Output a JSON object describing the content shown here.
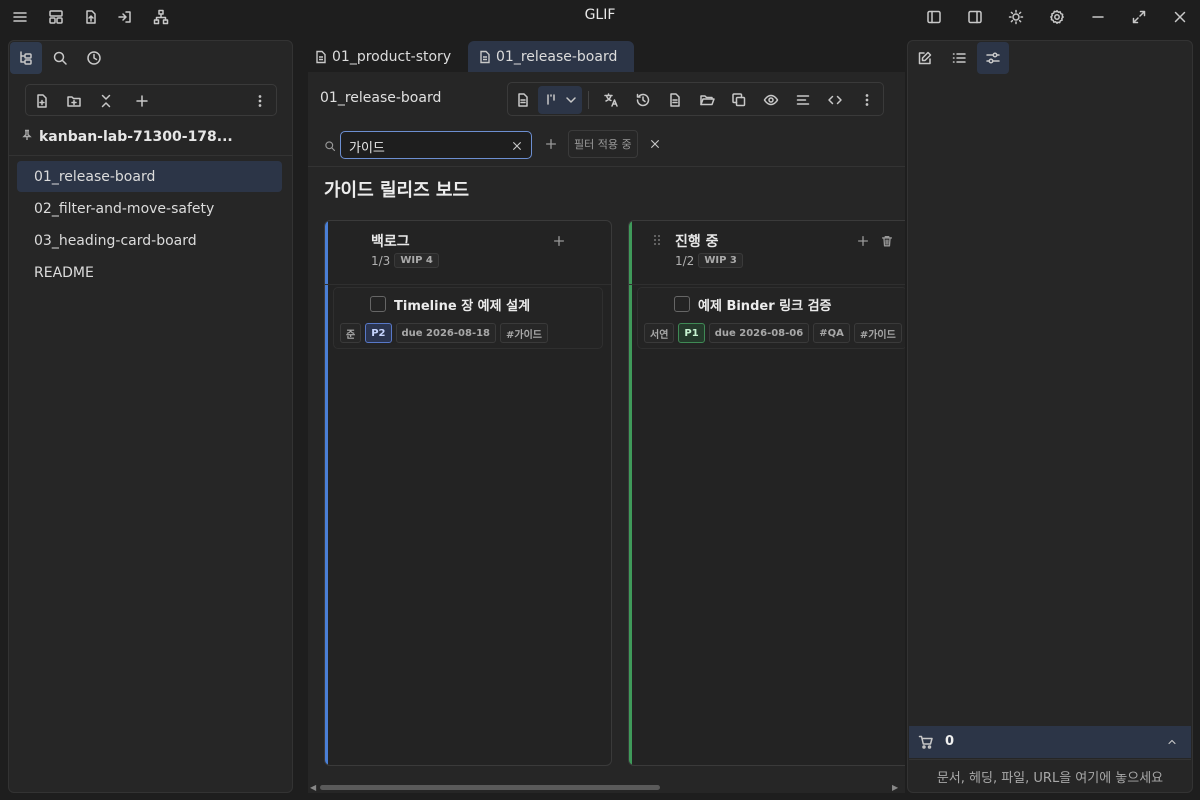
{
  "app": {
    "title": "GLIF"
  },
  "titlebar": {
    "left_icons": [
      "menu-icon",
      "layout-icon",
      "file-upload-icon",
      "log-in-icon",
      "network-icon"
    ],
    "right_icons": [
      "left-sidebar-toggle-icon",
      "right-sidebar-toggle-icon",
      "theme-sun-icon",
      "settings-gear-icon",
      "minimize-icon",
      "maximize-icon",
      "close-icon"
    ]
  },
  "left_panel": {
    "tabs": [
      "file-tree-icon",
      "search-icon",
      "history-clock-icon"
    ],
    "toolbar": [
      "new-file-icon",
      "new-folder-icon",
      "collapse-all-icon",
      "add-icon",
      "more-vertical-icon"
    ],
    "vault_name": "kanban-lab-71300-178...",
    "files": [
      {
        "label": "01_release-board",
        "active": true
      },
      {
        "label": "02_filter-and-move-safety",
        "active": false
      },
      {
        "label": "03_heading-card-board",
        "active": false
      },
      {
        "label": "README",
        "active": false
      }
    ]
  },
  "center": {
    "tabs": [
      {
        "label": "01_product-story",
        "active": false
      },
      {
        "label": "01_release-board",
        "active": true
      }
    ],
    "view_title": "01_release-board",
    "toolbar_icons": [
      "document-icon",
      "kanban-view-icon",
      "chevron-down-icon",
      "translate-icon",
      "history-icon",
      "file-text-icon",
      "folder-open-icon",
      "copy-icon",
      "eye-icon",
      "align-icon",
      "code-icon",
      "more-vertical-icon"
    ],
    "filter": {
      "value": "가이드",
      "placeholder": "",
      "chip_label": "필터 적용 중"
    },
    "board_title": "가이드 릴리즈 보드",
    "lanes": [
      {
        "title": "백로그",
        "count": "1/3",
        "wip": "WIP 4",
        "color": "#4a7fd6",
        "cards": [
          {
            "title": "Timeline 장 예제 설계",
            "owner": "준",
            "priority": "P2",
            "due": "due 2026-08-18",
            "tags": [
              "#가이드"
            ]
          }
        ]
      },
      {
        "title": "진행 중",
        "count": "1/2",
        "wip": "WIP 3",
        "color": "#3f9a5a",
        "cards": [
          {
            "title": "예제 Binder 링크 검증",
            "owner": "서연",
            "priority": "P1",
            "due": "due 2026-08-06",
            "tags": [
              "#QA",
              "#가이드"
            ]
          }
        ]
      }
    ]
  },
  "right_panel": {
    "tabs": [
      "edit-icon",
      "list-icon",
      "sliders-icon"
    ],
    "cart": {
      "count": "0",
      "hint": "문서, 헤딩, 파일, URL을 여기에 놓으세요"
    }
  }
}
